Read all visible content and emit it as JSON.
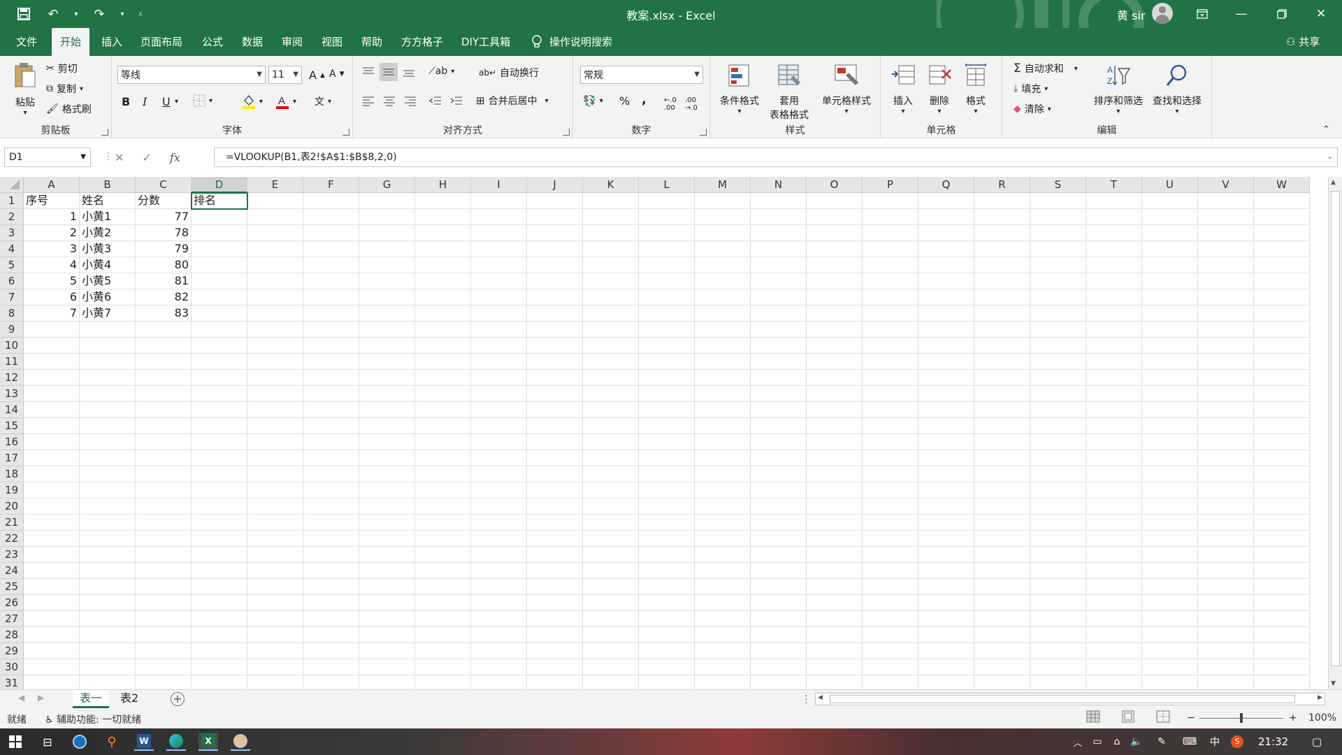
{
  "window": {
    "title": "教案.xlsx  -  Excel",
    "user": "黄 sir"
  },
  "menu": {
    "tabs": [
      "文件",
      "开始",
      "插入",
      "页面布局",
      "公式",
      "数据",
      "审阅",
      "视图",
      "帮助",
      "方方格子",
      "DIY工具箱"
    ],
    "active": "开始",
    "search": "操作说明搜索",
    "share": "共享"
  },
  "ribbon": {
    "clipboard": {
      "label": "剪贴板",
      "paste": "粘贴",
      "cut": "剪切",
      "copy": "复制",
      "format_painter": "格式刷"
    },
    "font": {
      "label": "字体",
      "name": "等线",
      "size": "11",
      "bold": "B",
      "italic": "I",
      "underline": "U",
      "grow": "A",
      "shrink": "A"
    },
    "alignment": {
      "label": "对齐方式",
      "wrap": "自动换行",
      "merge": "合并后居中"
    },
    "number": {
      "label": "数字",
      "format": "常规",
      "percent": "%",
      "comma": ","
    },
    "styles": {
      "label": "样式",
      "conditional": "条件格式",
      "table_format_1": "套用",
      "table_format_2": "表格格式",
      "cell_styles": "单元格样式"
    },
    "cells": {
      "label": "单元格",
      "insert": "插入",
      "delete": "删除",
      "format": "格式"
    },
    "editing": {
      "label": "编辑",
      "autosum": "自动求和",
      "fill": "填充",
      "clear": "清除",
      "sort_filter": "排序和筛选",
      "find_select": "查找和选择"
    }
  },
  "formula_bar": {
    "name_box": "D1",
    "fx": "fx",
    "formula": "=VLOOKUP(B1,表2!$A$1:$B$8,2,0)"
  },
  "grid": {
    "columns": [
      "A",
      "B",
      "C",
      "D",
      "E",
      "F",
      "G",
      "H",
      "I",
      "J",
      "K",
      "L",
      "M",
      "N",
      "O",
      "P",
      "Q",
      "R",
      "S",
      "T",
      "U",
      "V",
      "W"
    ],
    "selected_column": "D",
    "row_numbers": [
      "1",
      "2",
      "3",
      "4",
      "5",
      "6",
      "7",
      "8",
      "9",
      "10",
      "11",
      "12",
      "13",
      "14",
      "15",
      "16",
      "17",
      "18",
      "19",
      "20",
      "21",
      "22",
      "23",
      "24",
      "25",
      "26",
      "27",
      "28",
      "29",
      "30",
      "31"
    ],
    "active_cell": "D1",
    "rows": [
      [
        "序号",
        "姓名",
        "分数",
        "排名"
      ],
      [
        "1",
        "小黄1",
        "77",
        ""
      ],
      [
        "2",
        "小黄2",
        "78",
        ""
      ],
      [
        "3",
        "小黄3",
        "79",
        ""
      ],
      [
        "4",
        "小黄4",
        "80",
        ""
      ],
      [
        "5",
        "小黄5",
        "81",
        ""
      ],
      [
        "6",
        "小黄6",
        "82",
        ""
      ],
      [
        "7",
        "小黄7",
        "83",
        ""
      ]
    ]
  },
  "sheets": {
    "tabs": [
      "表一",
      "表2"
    ],
    "active": "表一",
    "add": "+"
  },
  "status": {
    "ready": "就绪",
    "accessibility": "辅助功能: 一切就绪",
    "zoom": "100%",
    "zoom_minus": "−",
    "zoom_plus": "+"
  },
  "taskbar": {
    "time": "21:32",
    "ime": "中"
  }
}
